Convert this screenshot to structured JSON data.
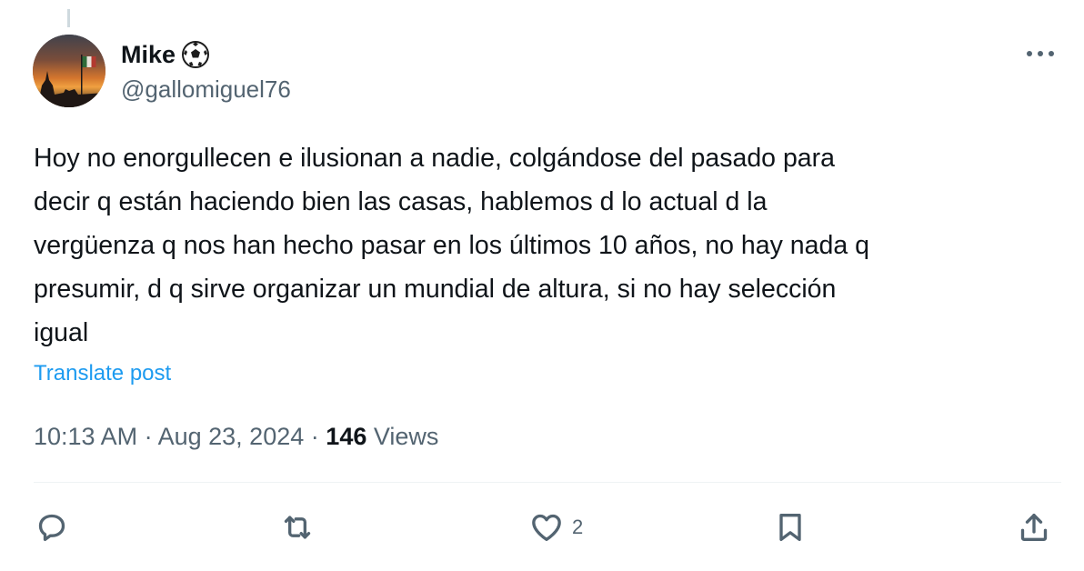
{
  "author": {
    "name": "Mike",
    "name_emoji": "soccer-ball-icon",
    "handle": "@gallomiguel76"
  },
  "tweet": {
    "text": "Hoy no enorgullecen e ilusionan a nadie, colgándose del pasado para\ndecir q están haciendo bien las casas, hablemos d lo actual d la\nvergüenza q nos han hecho pasar en los últimos 10 años, no hay nada q\npresumir, d q sirve organizar un mundial de altura, si no hay selección\nigual",
    "translate_label": "Translate post",
    "time": "10:13 AM",
    "date": "Aug 23, 2024",
    "separator": "·",
    "views_count": "146",
    "views_label": "Views"
  },
  "actions": {
    "reply": {
      "icon": "reply-icon",
      "count": ""
    },
    "retweet": {
      "icon": "retweet-icon",
      "count": ""
    },
    "like": {
      "icon": "heart-icon",
      "count": "2"
    },
    "bookmark": {
      "icon": "bookmark-icon",
      "count": ""
    },
    "share": {
      "icon": "share-icon",
      "count": ""
    }
  },
  "colors": {
    "text_primary": "#0f1419",
    "text_secondary": "#536471",
    "link": "#1d9bf0",
    "divider": "#eff3f4"
  }
}
